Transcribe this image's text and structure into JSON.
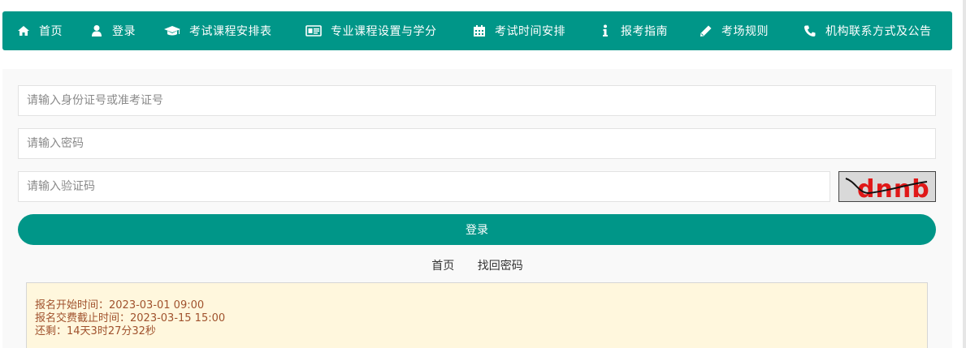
{
  "nav": {
    "items": [
      {
        "label": "首页",
        "icon": "home-icon"
      },
      {
        "label": "登录",
        "icon": "user-icon"
      },
      {
        "label": "考试课程安排表",
        "icon": "graduation-cap-icon"
      },
      {
        "label": "专业课程设置与学分",
        "icon": "id-card-icon"
      },
      {
        "label": "考试时间安排",
        "icon": "calendar-icon"
      },
      {
        "label": "报考指南",
        "icon": "info-icon"
      },
      {
        "label": "考场规则",
        "icon": "pencil-icon"
      },
      {
        "label": "机构联系方式及公告",
        "icon": "phone-icon"
      }
    ]
  },
  "form": {
    "id_placeholder": "请输入身份证号或准考证号",
    "password_placeholder": "请输入密码",
    "captcha_placeholder": "请输入验证码",
    "captcha_text": "dnnb",
    "login_label": "登录"
  },
  "links": {
    "home": "首页",
    "recover": "找回密码"
  },
  "notice": {
    "start": "报名开始时间：2023-03-01 09:00",
    "deadline": "报名交费截止时间：2023-03-15 15:00",
    "remaining": "还剩：14天3时27分32秒"
  },
  "colors": {
    "primary": "#009688",
    "notice_bg": "#fff7dd",
    "notice_text": "#a0522d"
  }
}
